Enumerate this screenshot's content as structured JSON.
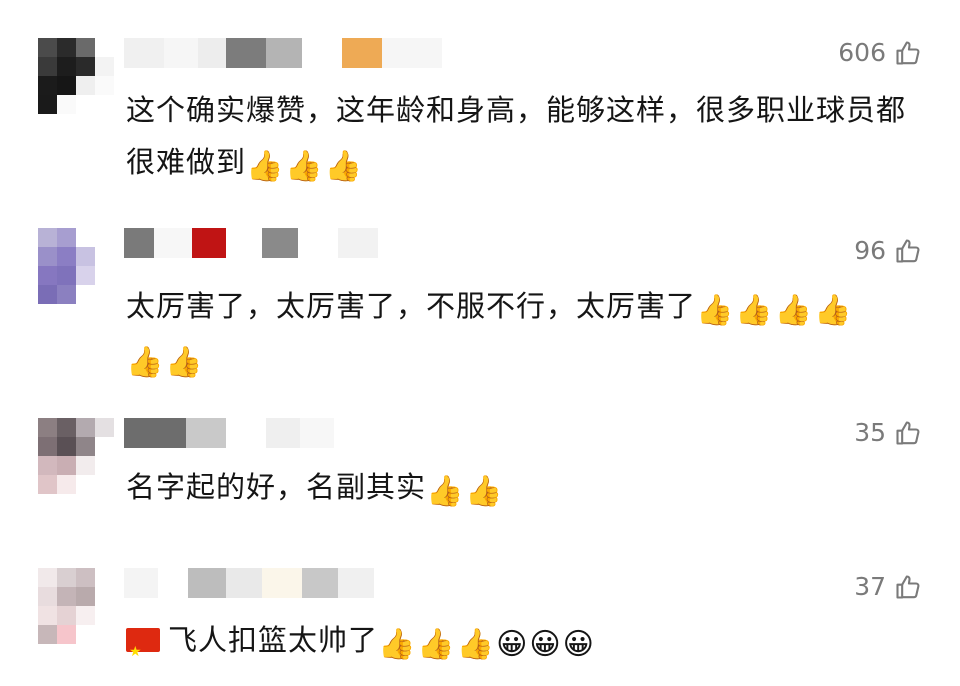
{
  "comments": [
    {
      "likes": "606",
      "text": "这个确实爆赞，这年龄和身高，能够这样，很多职业球员都很难做到",
      "emojis": [
        "👍",
        "👍",
        "👍"
      ]
    },
    {
      "likes": "96",
      "text": "太厉害了，太厉害了，不服不行，太厉害了",
      "emojis": [
        "👍",
        "👍",
        "👍",
        "👍",
        "👍",
        "👍"
      ]
    },
    {
      "likes": "35",
      "text": "名字起的好，名副其实",
      "emojis": [
        "👍",
        "👍"
      ]
    },
    {
      "likes": "37",
      "text": "飞人扣篮太帅了",
      "emojis": [
        "👍",
        "👍",
        "👍",
        "😀",
        "😀",
        "😀"
      ]
    }
  ],
  "icons": {
    "like": "thumbs-up-outline-icon",
    "flag": "china-flag-icon"
  },
  "colors": {
    "like_count": "#7a7a7a",
    "text": "#151515"
  }
}
